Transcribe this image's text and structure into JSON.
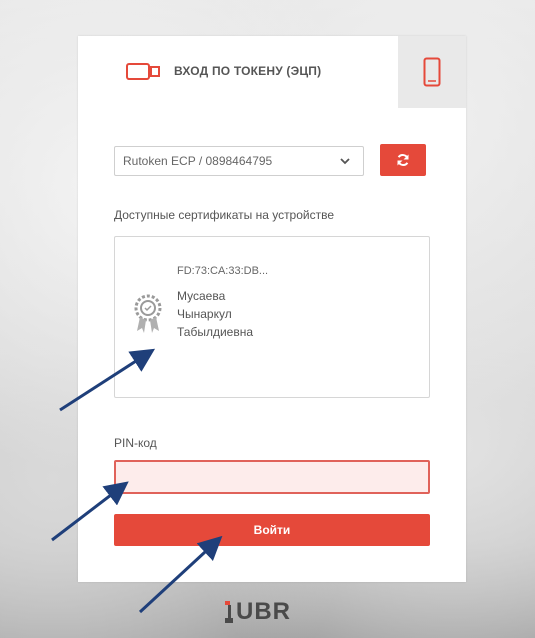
{
  "tabs": {
    "token_label": "ВХОД ПО ТОКЕНУ (ЭЦП)"
  },
  "device_select": {
    "value": "Rutoken ECP / 0898464795"
  },
  "certificates": {
    "label": "Доступные сертификаты на устройстве",
    "items": [
      {
        "id": "FD:73:CA:33:DB...",
        "name_lines": [
          "Мусаева",
          "Чынаркул",
          "Табылдиевна"
        ]
      }
    ]
  },
  "pin": {
    "label": "PIN-код",
    "value": ""
  },
  "login_button": {
    "label": "Войти"
  },
  "logo": {
    "text": "UBR"
  },
  "colors": {
    "accent": "#e5493a",
    "input_error_border": "#e0625a",
    "input_error_bg": "#fdeceb",
    "arrow": "#1f3f7a"
  }
}
